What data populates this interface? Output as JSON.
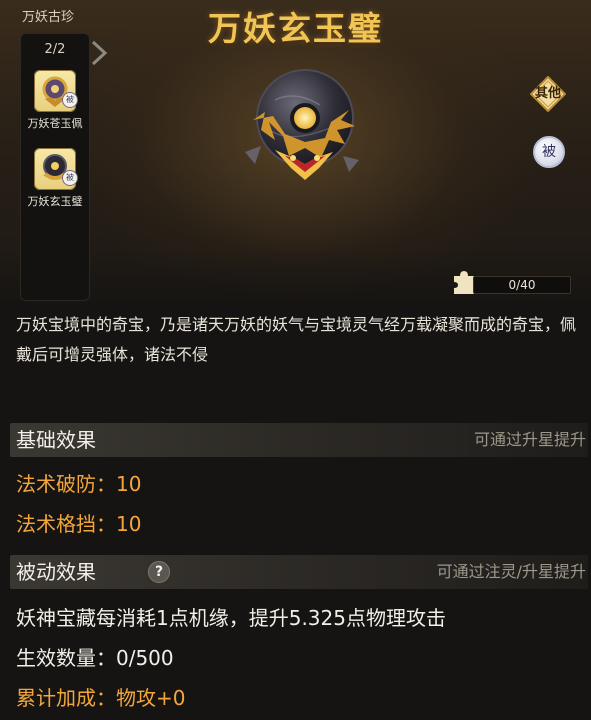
{
  "title": "万妖玄玉璧",
  "category": {
    "label": "万妖古珍",
    "count": "2/2",
    "items": [
      {
        "name": "万妖苍玉佩",
        "badge": "被",
        "icon": "jade-pendant-icon"
      },
      {
        "name": "万妖玄玉璧",
        "badge": "被",
        "icon": "jade-disc-icon"
      }
    ]
  },
  "side_buttons": {
    "other": "其他",
    "passive": "被"
  },
  "fragment": {
    "text": "0/40",
    "current": 0,
    "total": 40
  },
  "description": "万妖宝境中的奇宝，乃是诸天万妖的妖气与宝境灵气经万载凝聚而成的奇宝，佩戴后可增灵强体，诸法不侵",
  "basic": {
    "title": "基础效果",
    "hint": "可通过升星提升",
    "stats": [
      "法术破防：10",
      "法术格挡：10"
    ]
  },
  "passive": {
    "title": "被动效果",
    "help": "?",
    "hint": "可通过注灵/升星提升",
    "effect": "妖神宝藏每消耗1点机缘，提升5.325点物理攻击",
    "count": "生效数量：0/500",
    "bonus": "累计加成：物攻+0"
  },
  "colors": {
    "title_gold": "#f0c455",
    "stat_orange": "#f3a73a",
    "section_bg": "#3b3833"
  }
}
